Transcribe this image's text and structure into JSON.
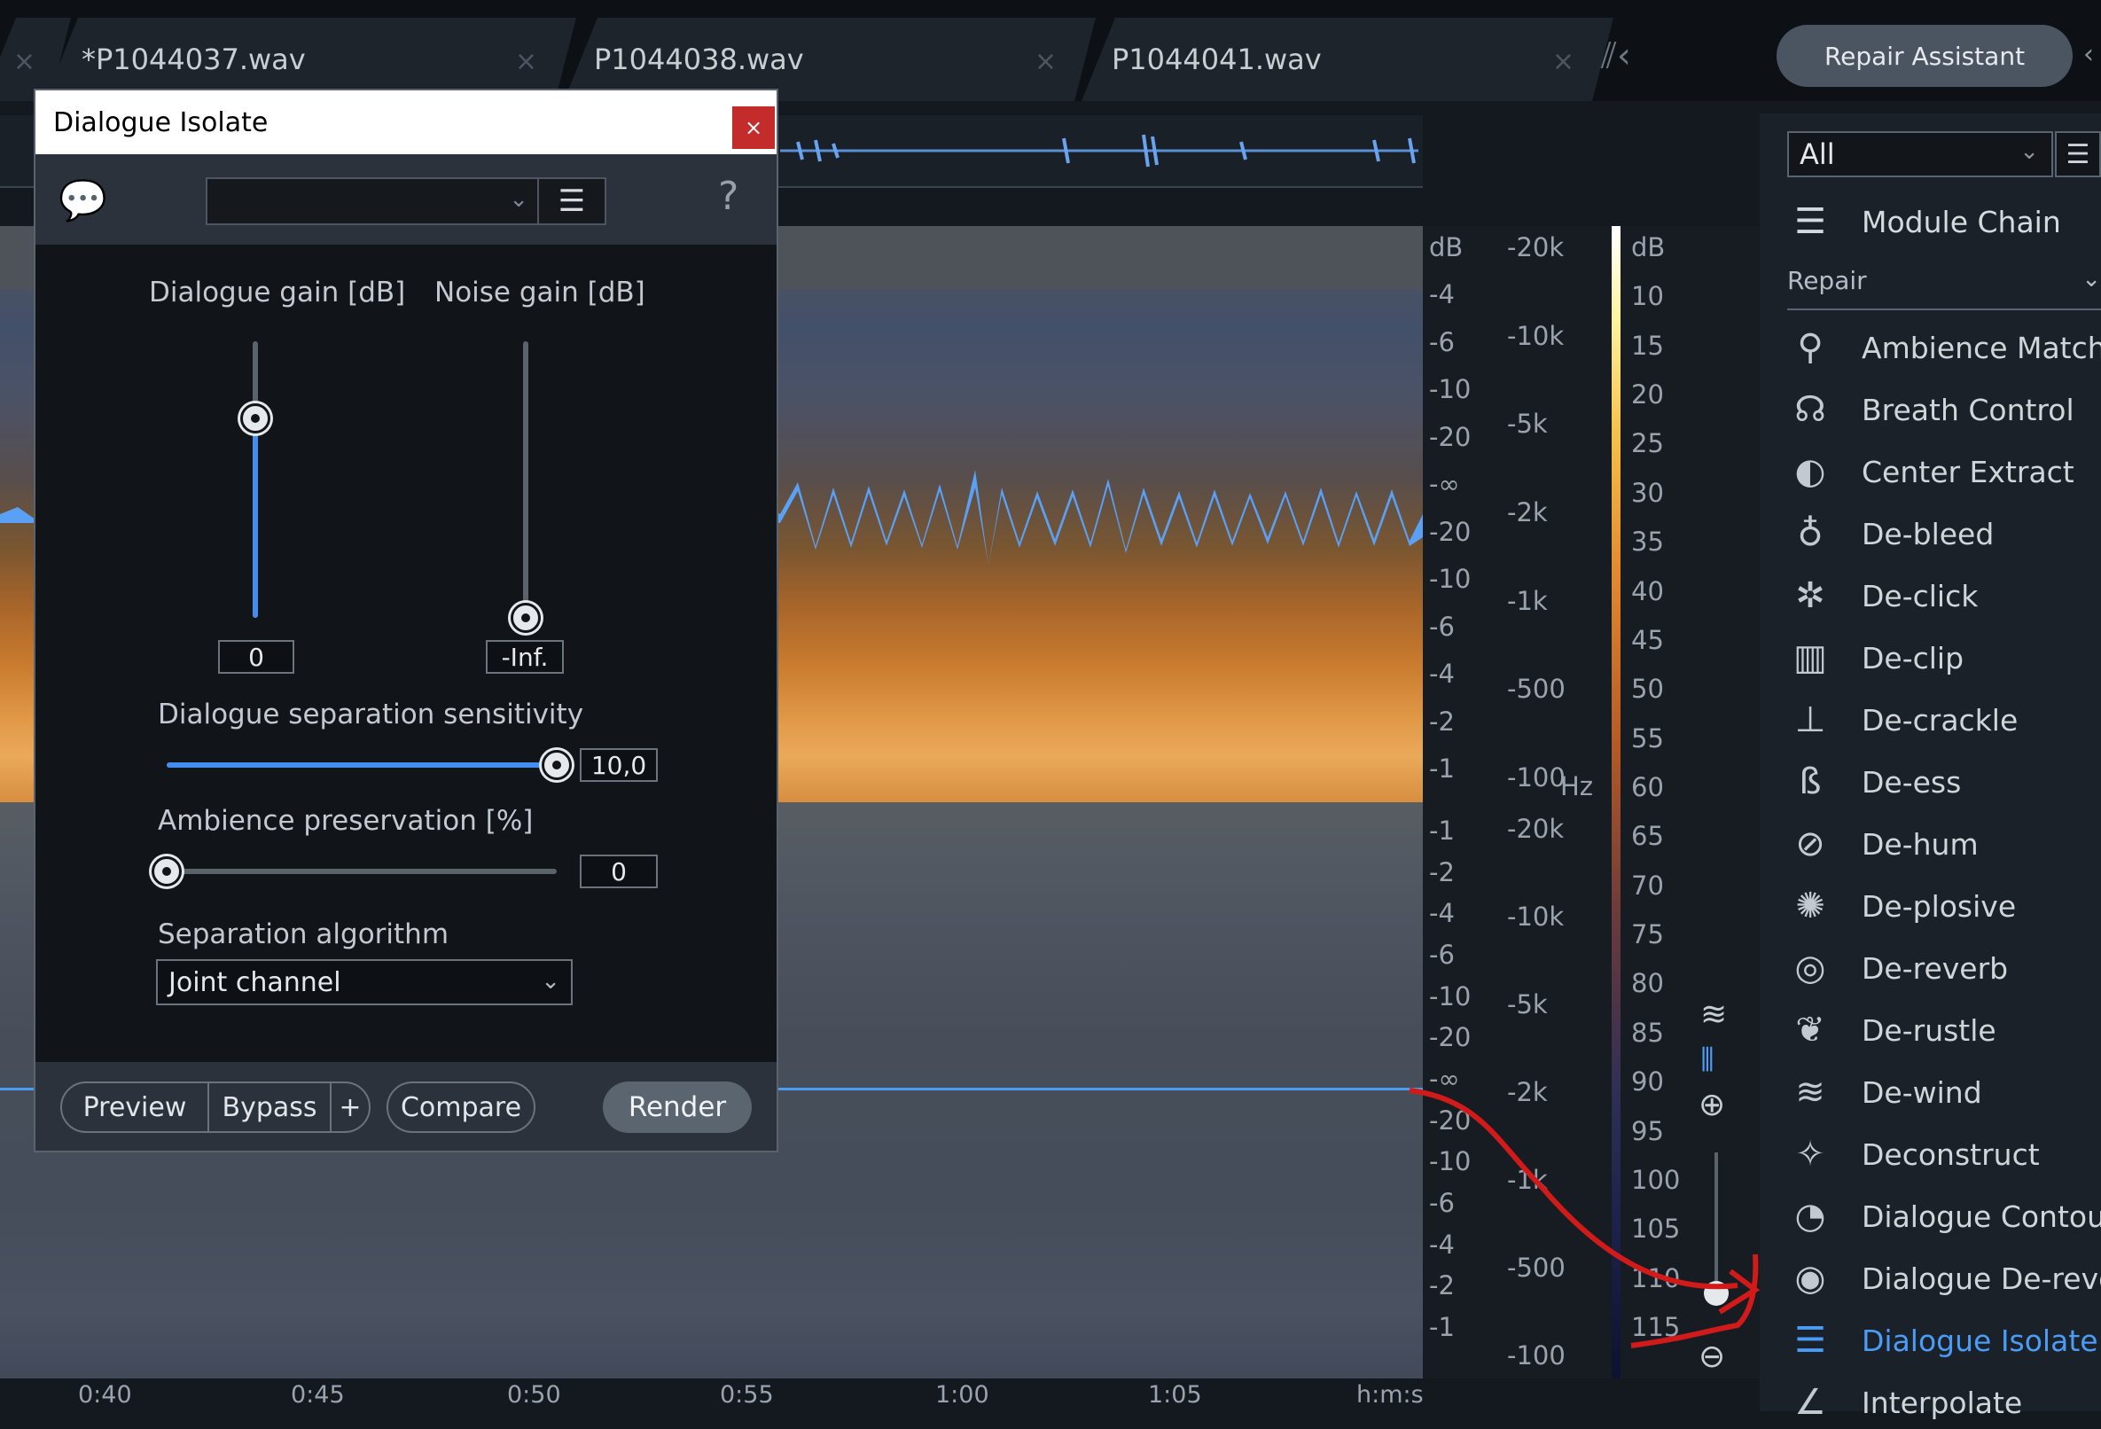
{
  "tabs": [
    {
      "name": "*P1044037.wav"
    },
    {
      "name": "P1044038.wav"
    },
    {
      "name": "P1044041.wav"
    }
  ],
  "header": {
    "repair_assistant": "Repair Assistant"
  },
  "right_panel": {
    "filter_value": "All",
    "module_chain": "Module Chain",
    "section": "Repair",
    "modules": [
      {
        "label": "Ambience Match",
        "icon": "ambience-match-icon",
        "glyph": "⚲"
      },
      {
        "label": "Breath Control",
        "icon": "breath-control-icon",
        "glyph": "☊"
      },
      {
        "label": "Center Extract",
        "icon": "center-extract-icon",
        "glyph": "◐"
      },
      {
        "label": "De-bleed",
        "icon": "de-bleed-icon",
        "glyph": "♁"
      },
      {
        "label": "De-click",
        "icon": "de-click-icon",
        "glyph": "✲"
      },
      {
        "label": "De-clip",
        "icon": "de-clip-icon",
        "glyph": "▥"
      },
      {
        "label": "De-crackle",
        "icon": "de-crackle-icon",
        "glyph": "⊥"
      },
      {
        "label": "De-ess",
        "icon": "de-ess-icon",
        "glyph": "ß"
      },
      {
        "label": "De-hum",
        "icon": "de-hum-icon",
        "glyph": "⊘"
      },
      {
        "label": "De-plosive",
        "icon": "de-plosive-icon",
        "glyph": "✺"
      },
      {
        "label": "De-reverb",
        "icon": "de-reverb-icon",
        "glyph": "◎"
      },
      {
        "label": "De-rustle",
        "icon": "de-rustle-icon",
        "glyph": "❦"
      },
      {
        "label": "De-wind",
        "icon": "de-wind-icon",
        "glyph": "≋"
      },
      {
        "label": "Deconstruct",
        "icon": "deconstruct-icon",
        "glyph": "✧"
      },
      {
        "label": "Dialogue Contour",
        "icon": "dialogue-contour-icon",
        "glyph": "◔"
      },
      {
        "label": "Dialogue De-reverb",
        "icon": "dialogue-de-reverb-icon",
        "glyph": "◉"
      },
      {
        "label": "Dialogue Isolate",
        "icon": "dialogue-isolate-icon",
        "glyph": "☰",
        "active": true
      },
      {
        "label": "Interpolate",
        "icon": "interpolate-icon",
        "glyph": "∠"
      }
    ]
  },
  "dialog": {
    "title": "Dialogue Isolate",
    "close": "×",
    "help": "?",
    "preset_value": "",
    "dialogue_gain_label": "Dialogue gain [dB]",
    "dialogue_gain_value": "0",
    "dialogue_gain_level": 0.72,
    "noise_gain_label": "Noise gain [dB]",
    "noise_gain_value": "-Inf.",
    "noise_gain_level": 0.0,
    "sensitivity_label": "Dialogue separation sensitivity",
    "sensitivity_value": "10,0",
    "sensitivity_level": 1.0,
    "ambience_label": "Ambience preservation [%]",
    "ambience_value": "0",
    "ambience_level": 0.0,
    "algorithm_label": "Separation algorithm",
    "algorithm_value": "Joint channel",
    "buttons": {
      "preview": "Preview",
      "bypass": "Bypass",
      "plus": "+",
      "compare": "Compare",
      "render": "Render"
    }
  },
  "editor": {
    "amp_top": [
      "dB",
      "-4",
      "-6",
      "-10",
      "-20",
      "-∞",
      "-20",
      "-10",
      "-6",
      "-4",
      "-2",
      "-1"
    ],
    "amp_bottom": [
      "-1",
      "-2",
      "-4",
      "-6",
      "-10",
      "-20",
      "-∞",
      "-20",
      "-10",
      "-6",
      "-4",
      "-2",
      "-1"
    ],
    "freq_top": [
      "-20k",
      "-10k",
      "-5k",
      "-2k",
      "-1k",
      "-500",
      "-100"
    ],
    "freq_unit": "Hz",
    "freq_bottom": [
      "-20k",
      "-10k",
      "-5k",
      "-2k",
      "-1k",
      "-500",
      "-100"
    ],
    "db_scale": [
      "dB",
      "10",
      "15",
      "20",
      "25",
      "30",
      "35",
      "40",
      "45",
      "50",
      "55",
      "60",
      "65",
      "70",
      "75",
      "80",
      "85",
      "90",
      "95",
      "100",
      "105",
      "110",
      "115"
    ],
    "timeline": [
      "0:40",
      "0:45",
      "0:50",
      "0:55",
      "1:00",
      "1:05",
      "h:m:s"
    ]
  }
}
